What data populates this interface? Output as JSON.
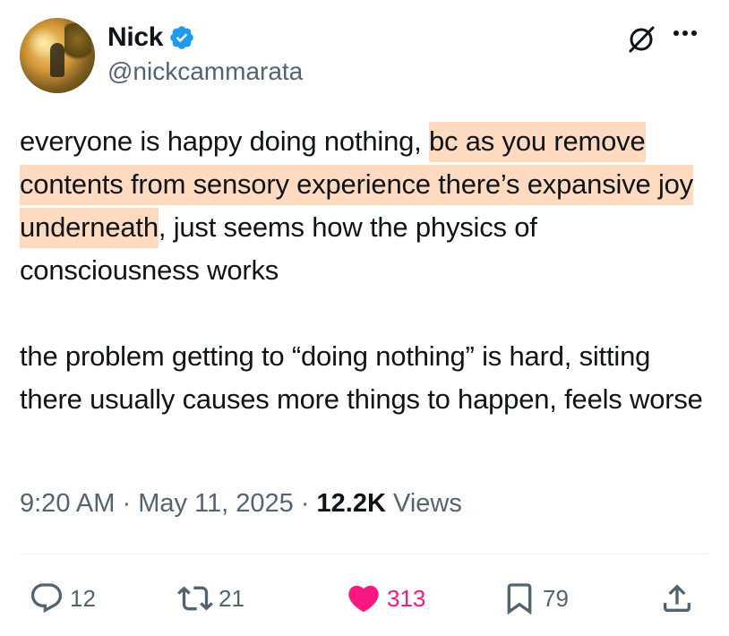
{
  "author": {
    "display_name": "Nick",
    "handle": "@nickcammarata",
    "verified": true,
    "verified_color": "#1d9bf0"
  },
  "tweet": {
    "paragraphs": [
      {
        "before": "everyone is happy doing nothing, ",
        "highlight": "bc as you remove contents from sensory experience there’s expansive joy underneath",
        "after": ", just seems how the physics of consciousness works"
      },
      {
        "text": "the problem getting to “doing nothing” is hard, sitting there usually causes more things to happen, feels worse"
      }
    ],
    "highlight_color": "#fedbc0"
  },
  "meta": {
    "time": "9:20 AM",
    "separator": " · ",
    "date": "May 11, 2025",
    "views_count": "12.2K",
    "views_label": " Views"
  },
  "actions": {
    "reply": {
      "icon": "reply-icon",
      "count": "12"
    },
    "retweet": {
      "icon": "retweet-icon",
      "count": "21"
    },
    "like": {
      "icon": "heart-icon",
      "count": "313",
      "color": "#f91880",
      "active": true
    },
    "bookmark": {
      "icon": "bookmark-icon",
      "count": "79"
    },
    "share": {
      "icon": "share-icon"
    }
  },
  "colors": {
    "text": "#0f1419",
    "secondary": "#536471",
    "like": "#f91880",
    "verified": "#1d9bf0"
  }
}
